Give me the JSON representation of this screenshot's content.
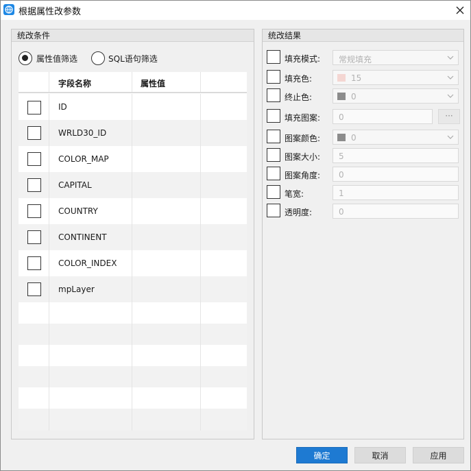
{
  "window": {
    "title": "根据属性改参数"
  },
  "left_panel": {
    "title": "统改条件",
    "radios": [
      {
        "label": "属性值筛选",
        "selected": true
      },
      {
        "label": "SQL语句筛选",
        "selected": false
      }
    ],
    "table": {
      "headers": [
        "字段名称",
        "属性值"
      ],
      "rows": [
        {
          "field": "ID",
          "value": ""
        },
        {
          "field": "WRLD30_ID",
          "value": ""
        },
        {
          "field": "COLOR_MAP",
          "value": ""
        },
        {
          "field": "CAPITAL",
          "value": ""
        },
        {
          "field": "COUNTRY",
          "value": ""
        },
        {
          "field": "CONTINENT",
          "value": ""
        },
        {
          "field": "COLOR_INDEX",
          "value": ""
        },
        {
          "field": "mpLayer",
          "value": ""
        }
      ]
    }
  },
  "right_panel": {
    "title": "统改结果",
    "fields": [
      {
        "label": "填充模式:",
        "value": "常规填充",
        "kind": "dropdown"
      },
      {
        "label": "填充色:",
        "value": "15",
        "kind": "color-dropdown",
        "color": "#f4d6d2"
      },
      {
        "label": "终止色:",
        "value": "0",
        "kind": "color-dropdown",
        "color": "#8c8c8c"
      },
      {
        "label": "填充图案:",
        "value": "0",
        "kind": "input-browse",
        "browse_label": "···"
      },
      {
        "label": "图案颜色:",
        "value": "0",
        "kind": "color-dropdown",
        "color": "#8c8c8c"
      },
      {
        "label": "图案大小:",
        "value": "5",
        "kind": "input"
      },
      {
        "label": "图案角度:",
        "value": "0",
        "kind": "input"
      },
      {
        "label": "笔宽:",
        "value": "1",
        "kind": "input"
      },
      {
        "label": "透明度:",
        "value": "0",
        "kind": "input"
      }
    ]
  },
  "buttons": {
    "ok": "确定",
    "cancel": "取消",
    "apply": "应用"
  },
  "colors": {
    "primary": "#1e7ad2",
    "alt_row": "#f2f2f2"
  }
}
